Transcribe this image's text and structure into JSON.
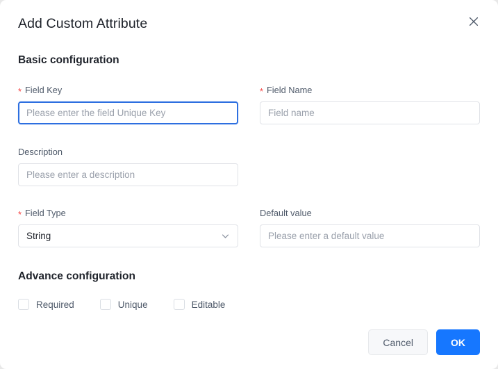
{
  "dialog": {
    "title": "Add Custom Attribute",
    "close_icon": "close-icon"
  },
  "sections": {
    "basic": "Basic configuration",
    "advance": "Advance configuration"
  },
  "fields": {
    "field_key": {
      "label": "Field Key",
      "required_marker": "*",
      "placeholder": "Please enter the field Unique Key",
      "value": ""
    },
    "field_name": {
      "label": "Field Name",
      "required_marker": "*",
      "placeholder": "Field name",
      "value": ""
    },
    "description": {
      "label": "Description",
      "placeholder": "Please enter a description",
      "value": ""
    },
    "field_type": {
      "label": "Field Type",
      "required_marker": "*",
      "selected": "String",
      "dropdown_icon": "chevron-down-icon"
    },
    "default_value": {
      "label": "Default value",
      "placeholder": "Please enter a default value",
      "value": ""
    }
  },
  "checkboxes": [
    {
      "label": "Required",
      "checked": false
    },
    {
      "label": "Unique",
      "checked": false
    },
    {
      "label": "Editable",
      "checked": false
    }
  ],
  "footer": {
    "cancel_label": "Cancel",
    "ok_label": "OK"
  },
  "colors": {
    "primary": "#1677ff",
    "focus_border": "#2d6fe0",
    "required_star": "#f53f3f",
    "text_primary": "#1d2129",
    "text_secondary": "#4e5969",
    "placeholder": "#9aa0ab",
    "border": "#e0e2e7"
  }
}
